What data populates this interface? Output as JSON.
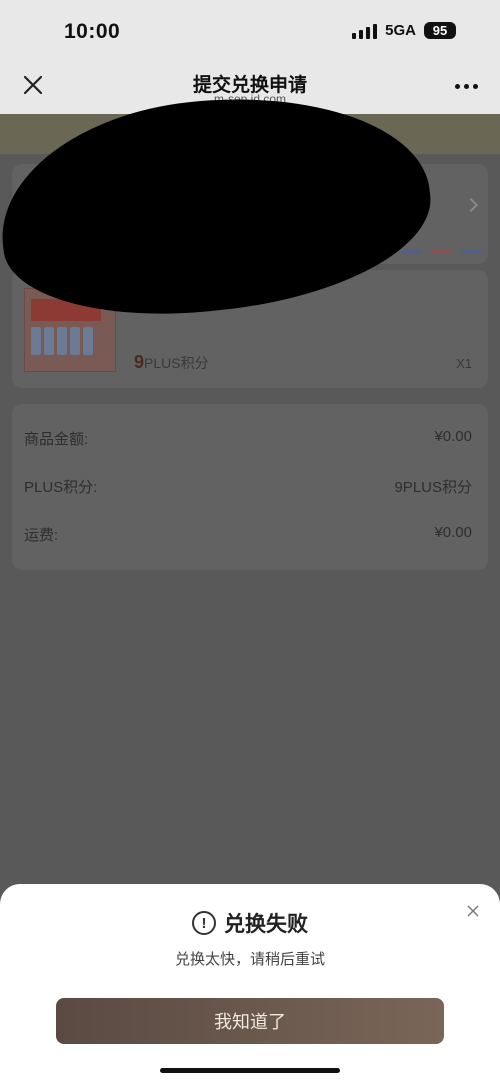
{
  "status_bar": {
    "time": "10:00",
    "network": "5GA",
    "battery": "95"
  },
  "nav": {
    "title": "提交兑换申请",
    "domain": "m-sep.jd.com"
  },
  "product": {
    "price_num": "9",
    "price_unit": "PLUS积分",
    "quantity": "X1"
  },
  "summary": {
    "rows": [
      {
        "label": "商品金额:",
        "value": "¥0.00"
      },
      {
        "label": "PLUS积分:",
        "value": "9PLUS积分"
      },
      {
        "label": "运费:",
        "value": "¥0.00"
      }
    ]
  },
  "dialog": {
    "title": "兑换失败",
    "message": "兑换太快，请稍后重试",
    "confirm_label": "我知道了"
  },
  "icons": {
    "close": "close-icon",
    "more": "more-icon",
    "warning": "warning-icon",
    "chevron": "chevron-right-icon"
  }
}
